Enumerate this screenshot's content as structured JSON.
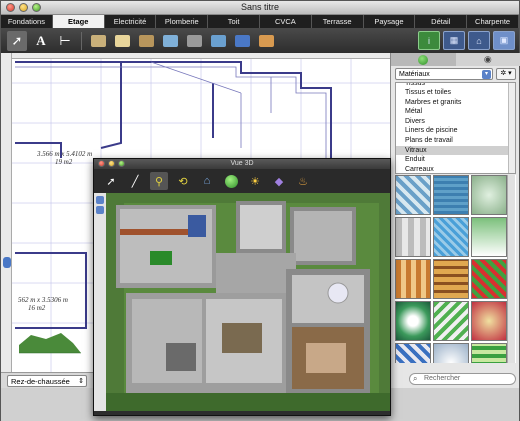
{
  "window": {
    "title": "Sans titre"
  },
  "tabs": [
    "Fondations",
    "Etage",
    "Electricité",
    "Plomberie",
    "Toit",
    "CVCA",
    "Terrasse",
    "Paysage",
    "Détail",
    "Charpente"
  ],
  "active_tab": "Etage",
  "toolbar": {
    "tools": [
      "select-arrow-icon",
      "text-tool-icon",
      "dimension-tool-icon",
      "wall-tool-icon",
      "floor-tool-icon",
      "door-tool-icon",
      "window-tool-icon",
      "stair-tool-icon",
      "fireplace-tool-icon",
      "column-tool-icon",
      "cabinet-tool-icon"
    ],
    "view_buttons": [
      "info-view",
      "plan-view",
      "elevation-view",
      "3d-view"
    ]
  },
  "plan": {
    "dimensions": [
      {
        "line1": "3.566 m x 5.4102 m",
        "line2": "19 m2"
      },
      {
        "line1": "562 m x 3.5306 m",
        "line2": "16 m2"
      }
    ],
    "level": "Rez-de-chaussée"
  },
  "panel": {
    "category": "Matériaux",
    "gear": "✲ ▾",
    "materials": [
      "Tissus",
      "Tissus et toiles",
      "Marbres et granits",
      "Métal",
      "Divers",
      "Liners de piscine",
      "Plans de travail",
      "Vitraux",
      "Enduit",
      "Carreaux"
    ],
    "selected_material": "Vitraux",
    "search_placeholder": "Rechercher"
  },
  "view3d": {
    "title": "Vue 3D"
  },
  "colors": {
    "accent": "#5b82c8",
    "tab_bar": "#1f1f1f",
    "grass": "#4f7a38"
  }
}
